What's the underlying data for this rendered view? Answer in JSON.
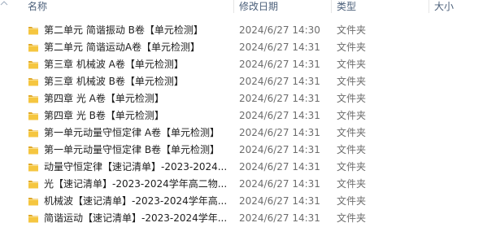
{
  "columns": {
    "name": "名称",
    "date": "修改日期",
    "type": "类型",
    "size": "大小"
  },
  "folder_icon": "folder-icon",
  "folder_color": "#f5c640",
  "files": [
    {
      "name": "第二单元  简谐振动 B卷【单元检测】",
      "date": "2024/6/27 14:30",
      "type": "文件夹"
    },
    {
      "name": "第二单元 简谐运动A卷【单元检测】",
      "date": "2024/6/27 14:31",
      "type": "文件夹"
    },
    {
      "name": "第三章  机械波  A卷【单元检测】",
      "date": "2024/6/27 14:31",
      "type": "文件夹"
    },
    {
      "name": "第三章  机械波  B卷【单元检测】",
      "date": "2024/6/27 14:31",
      "type": "文件夹"
    },
    {
      "name": "第四章  光 A卷【单元检测】",
      "date": "2024/6/27 14:31",
      "type": "文件夹"
    },
    {
      "name": "第四章  光 B卷【单元检测】",
      "date": "2024/6/27 14:31",
      "type": "文件夹"
    },
    {
      "name": "第一单元动量守恒定律  A卷【单元检测】",
      "date": "2024/6/27 14:31",
      "type": "文件夹"
    },
    {
      "name": "第一单元动量守恒定律 B卷【单元检测】",
      "date": "2024/6/27 14:31",
      "type": "文件夹"
    },
    {
      "name": "动量守恒定律【速记清单】-2023-2024...",
      "date": "2024/6/27 14:31",
      "type": "文件夹"
    },
    {
      "name": "光【速记清单】-2023-2024学年高二物...",
      "date": "2024/6/27 14:31",
      "type": "文件夹"
    },
    {
      "name": "机械波【速记清单】-2023-2024学年高...",
      "date": "2024/6/27 14:31",
      "type": "文件夹"
    },
    {
      "name": "简谐运动【速记清单】-2023-2024学年...",
      "date": "2024/6/27 14:31",
      "type": "文件夹"
    }
  ]
}
